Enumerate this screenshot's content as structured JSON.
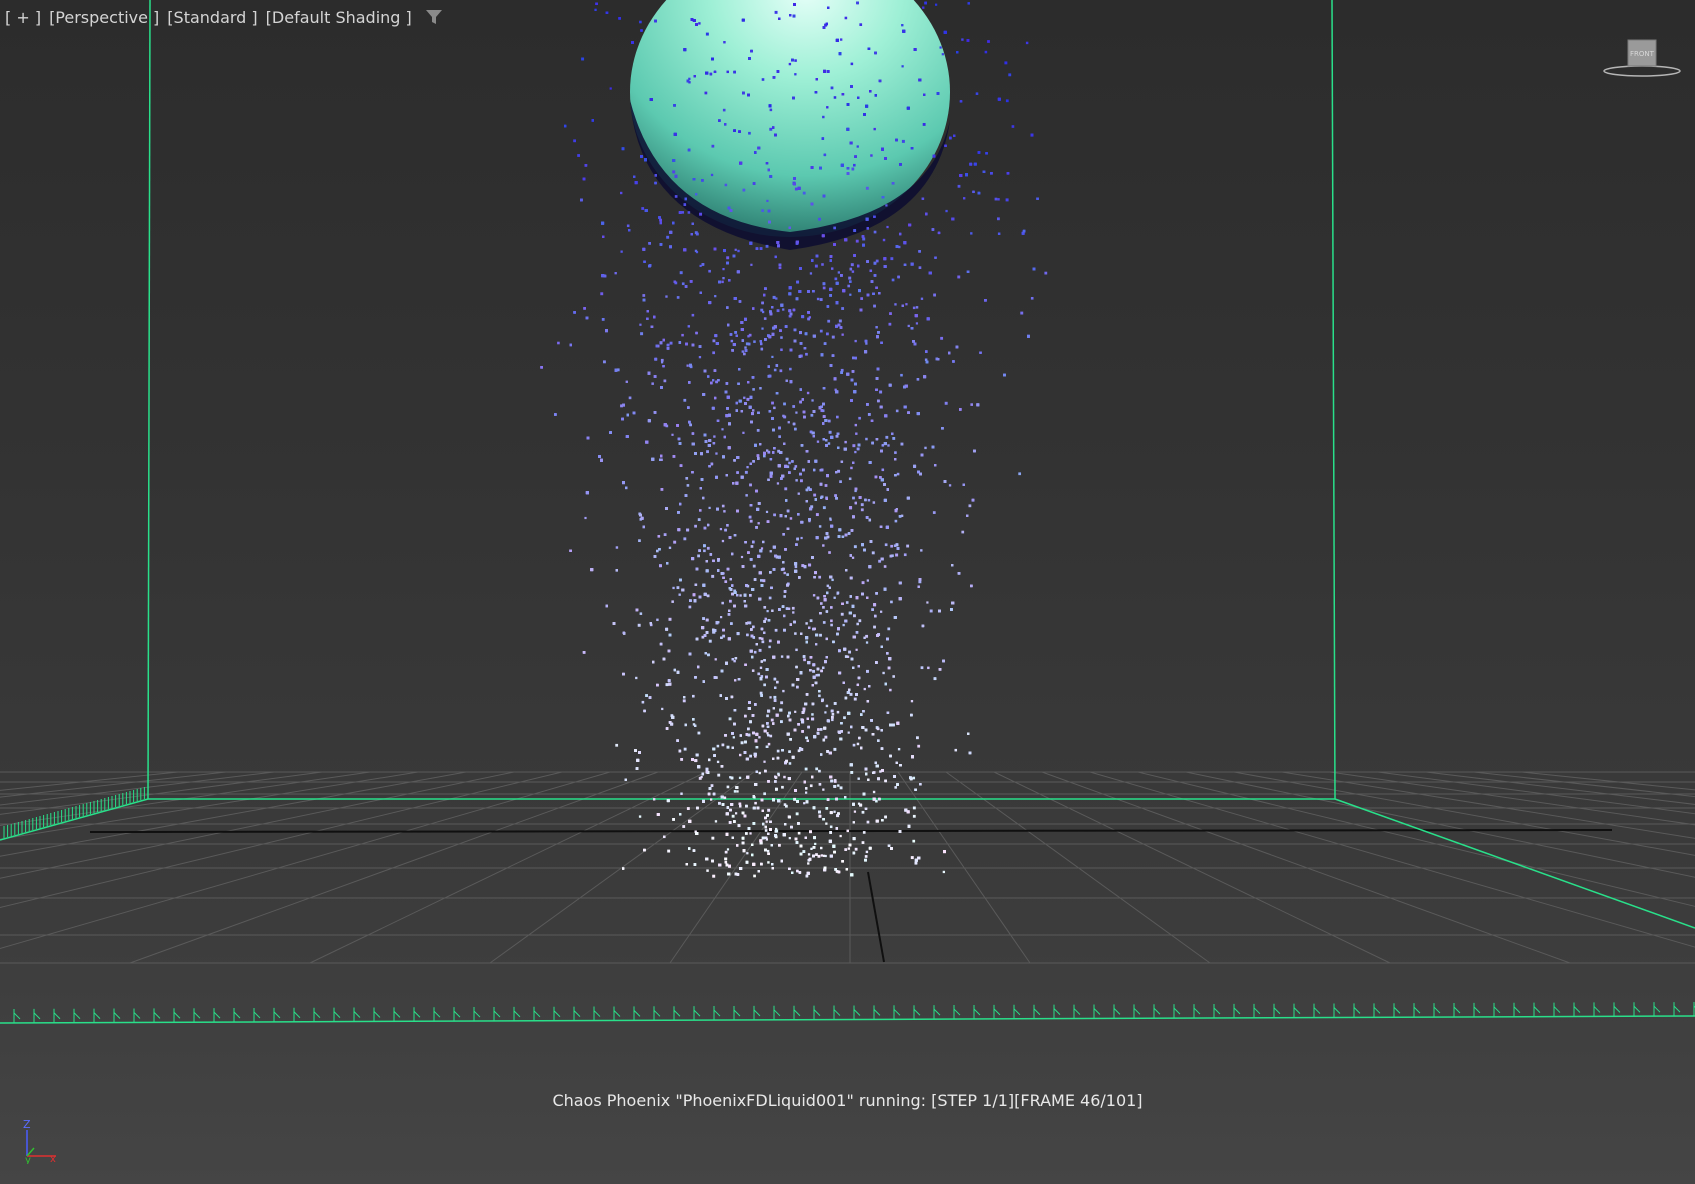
{
  "viewport": {
    "labels": {
      "plus": "[ + ]",
      "view": "[Perspective ]",
      "camera_mode": "[Standard ]",
      "shading": "[Default Shading ]"
    },
    "filter_icon": "funnel-filter-icon",
    "status_text": "Chaos Phoenix \"PhoenixFDLiquid001\" running: [STEP 1/1][FRAME 46/101]",
    "viewcube_label": "FRONT",
    "axis": {
      "z": "Z",
      "y": "y",
      "x": "x"
    }
  },
  "colors": {
    "container_lines": "#29e08a",
    "grid": "#595959",
    "sphere": "#7fe3c9",
    "particles_dark": "#3b3be8",
    "particles_light": "#eef0ff",
    "background": "#333333"
  }
}
